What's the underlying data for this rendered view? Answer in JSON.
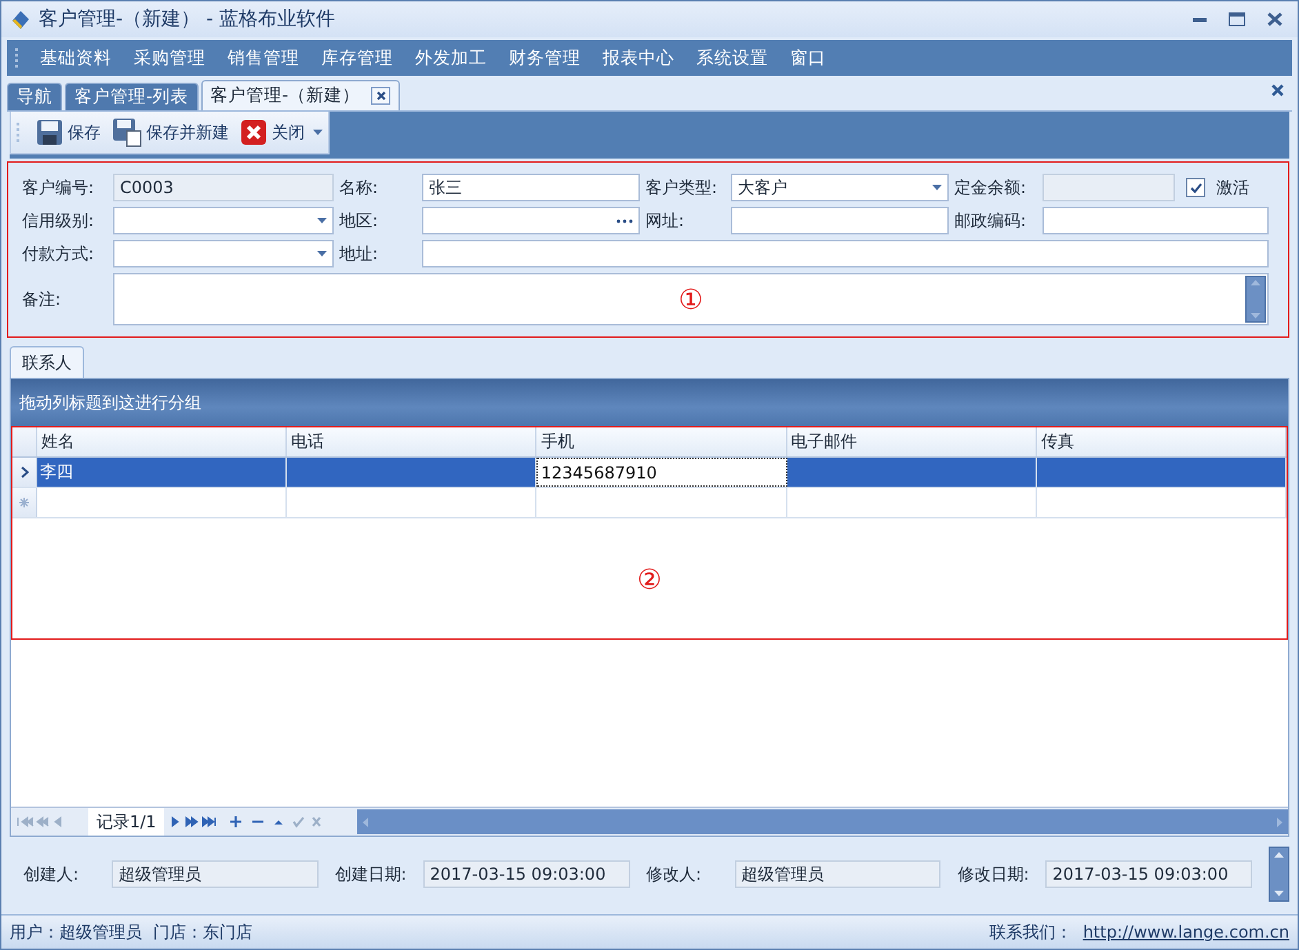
{
  "window": {
    "title": "客户管理-（新建） - 蓝格布业软件"
  },
  "menu": [
    "基础资料",
    "采购管理",
    "销售管理",
    "库存管理",
    "外发加工",
    "财务管理",
    "报表中心",
    "系统设置",
    "窗口"
  ],
  "tabs": [
    {
      "label": "导航",
      "selected": false,
      "closable": false
    },
    {
      "label": "客户管理-列表",
      "selected": false,
      "closable": false
    },
    {
      "label": "客户管理-（新建）",
      "selected": true,
      "closable": true
    }
  ],
  "toolbar": [
    {
      "label": "保存",
      "kind": "save"
    },
    {
      "label": "保存并新建",
      "kind": "save_new"
    },
    {
      "label": "关闭",
      "kind": "close"
    }
  ],
  "form": {
    "annotation": "①",
    "rows": [
      [
        {
          "label": "客户编号:",
          "kind": "readonly",
          "value": "C0003"
        },
        {
          "label": "名称:",
          "kind": "text",
          "value": "张三"
        },
        {
          "label": "客户类型:",
          "kind": "select",
          "value": "大客户"
        },
        {
          "label": "定金余额:",
          "kind": "readonly",
          "checkbox": {
            "label": "激活",
            "checked": true
          }
        }
      ],
      [
        {
          "label": "信用级别:",
          "kind": "select"
        },
        {
          "label": "地区:",
          "kind": "ellipsis"
        },
        {
          "label": "网址:",
          "kind": "text"
        },
        {
          "label": "邮政编码:",
          "kind": "text"
        }
      ],
      [
        {
          "label": "付款方式:",
          "kind": "select"
        },
        {
          "label": "地址:",
          "kind": "wide"
        }
      ],
      [
        {
          "label": "备注:",
          "kind": "memo"
        }
      ]
    ]
  },
  "detail_tabs": [
    {
      "label": "联系人",
      "selected": true
    }
  ],
  "grid": {
    "group_hint": "拖动列标题到这进行分组",
    "annotation": "②",
    "columns": [
      "姓名",
      "电话",
      "手机",
      "电子邮件",
      "传真"
    ],
    "rows": [
      {
        "kind": "data",
        "selected": true,
        "cells": [
          {
            "text": "李四",
            "editing": false
          },
          {
            "editing": false
          },
          {
            "text": "12345687910",
            "editing": true
          },
          {
            "editing": false
          },
          {
            "editing": false
          }
        ]
      },
      {
        "kind": "new",
        "selected": false,
        "cells": [
          {
            "editing": false
          },
          {
            "editing": false
          },
          {
            "editing": false
          },
          {
            "editing": false
          },
          {
            "editing": false
          }
        ]
      }
    ],
    "navigator": {
      "record": "记录1/1"
    }
  },
  "footer": [
    {
      "label": "创建人:",
      "value": "超级管理员"
    },
    {
      "label": "创建日期:",
      "value": "2017-03-15 09:03:00"
    },
    {
      "label": "修改人:",
      "value": "超级管理员"
    },
    {
      "label": "修改日期:",
      "value": "2017-03-15 09:03:00"
    }
  ],
  "status_bar": {
    "user": "用户：超级管理员",
    "store": "门店：东门店",
    "contact_label": "联系我们：",
    "link": "http://www.lange.com.cn"
  }
}
